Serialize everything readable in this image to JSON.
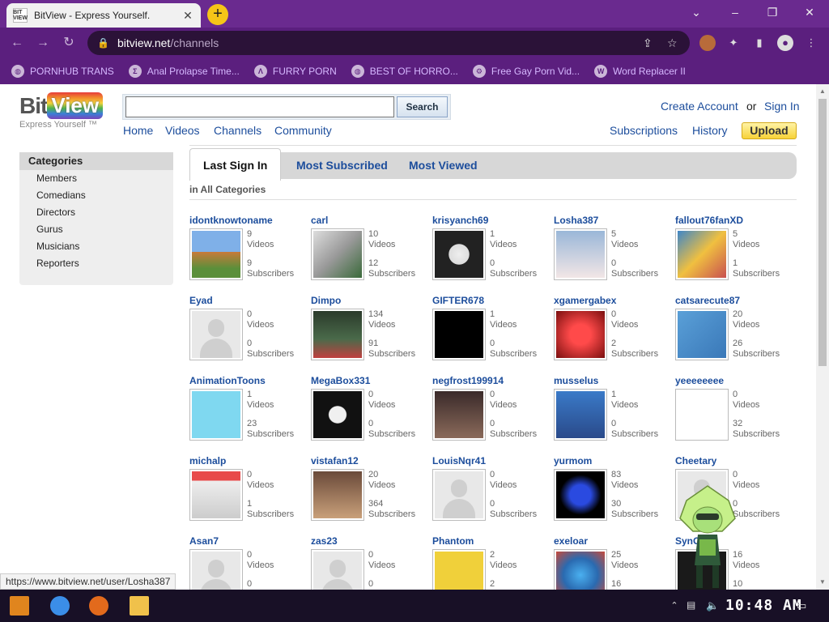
{
  "browser": {
    "tab_title": "BitView - Express Yourself.",
    "favicon_text": "BIT VIEW",
    "new_tab": "+",
    "url_host": "bitview.net",
    "url_path": "/channels",
    "status_url": "https://www.bitview.net/user/Losha387",
    "bookmarks": [
      {
        "label": "PORNHUB TRANS",
        "icon": "globe-icon"
      },
      {
        "label": "Anal Prolapse Time...",
        "icon": "sigma-icon"
      },
      {
        "label": "FURRY PORN",
        "icon": "lambda-icon"
      },
      {
        "label": "BEST OF HORRO...",
        "icon": "globe-icon"
      },
      {
        "label": "Free Gay Porn Vid...",
        "icon": "gear-icon"
      },
      {
        "label": "Word Replacer II",
        "icon": "wr-icon"
      }
    ]
  },
  "site": {
    "logo_bit": "Bit",
    "logo_view": "View",
    "tagline": "Express Yourself ™",
    "search_button": "Search",
    "search_value": "",
    "nav": [
      "Home",
      "Videos",
      "Channels",
      "Community"
    ],
    "create_account": "Create Account",
    "or": "or",
    "sign_in": "Sign In",
    "subscriptions": "Subscriptions",
    "history": "History",
    "upload": "Upload"
  },
  "sidebar": {
    "title": "Categories",
    "items": [
      "Members",
      "Comedians",
      "Directors",
      "Gurus",
      "Musicians",
      "Reporters"
    ]
  },
  "tabs": {
    "items": [
      "Last Sign In",
      "Most Subscribed",
      "Most Viewed"
    ],
    "active": "Last Sign In"
  },
  "filter_label": "in All Categories",
  "stat_labels": {
    "videos": "Videos",
    "subscribers": "Subscribers"
  },
  "channels": [
    {
      "name": "idontknowtoname",
      "videos": "9",
      "subscribers": "9"
    },
    {
      "name": "carl",
      "videos": "10",
      "subscribers": "12"
    },
    {
      "name": "krisyanch69",
      "videos": "1",
      "subscribers": "0"
    },
    {
      "name": "Losha387",
      "videos": "5",
      "subscribers": "0"
    },
    {
      "name": "fallout76fanXD",
      "videos": "5",
      "subscribers": "1"
    },
    {
      "name": "Eyad",
      "videos": "0",
      "subscribers": "0"
    },
    {
      "name": "Dimpo",
      "videos": "134",
      "subscribers": "91"
    },
    {
      "name": "GIFTER678",
      "videos": "1",
      "subscribers": "0"
    },
    {
      "name": "xgamergabex",
      "videos": "0",
      "subscribers": "2"
    },
    {
      "name": "catsarecute87",
      "videos": "20",
      "subscribers": "26"
    },
    {
      "name": "AnimationToons",
      "videos": "1",
      "subscribers": "23"
    },
    {
      "name": "MegaBox331",
      "videos": "0",
      "subscribers": "0"
    },
    {
      "name": "negfrost199914",
      "videos": "0",
      "subscribers": "0"
    },
    {
      "name": "musselus",
      "videos": "1",
      "subscribers": "0"
    },
    {
      "name": "yeeeeeeee",
      "videos": "0",
      "subscribers": "32"
    },
    {
      "name": "michalp",
      "videos": "0",
      "subscribers": "1"
    },
    {
      "name": "vistafan12",
      "videos": "20",
      "subscribers": "364"
    },
    {
      "name": "LouisNqr41",
      "videos": "0",
      "subscribers": "0"
    },
    {
      "name": "yurmom",
      "videos": "83",
      "subscribers": "30"
    },
    {
      "name": "Cheetary",
      "videos": "0",
      "subscribers": "0"
    },
    {
      "name": "Asan7",
      "videos": "0",
      "subscribers": "0"
    },
    {
      "name": "zas23",
      "videos": "0",
      "subscribers": "0"
    },
    {
      "name": "Phantom",
      "videos": "2",
      "subscribers": "2"
    },
    {
      "name": "exeloar",
      "videos": "25",
      "subscribers": "16"
    },
    {
      "name": "SynCr...d",
      "videos": "16",
      "subscribers": "10"
    }
  ],
  "taskbar": {
    "clock": "10:48 AM"
  },
  "colors": {
    "chrome": "#5b1f7e",
    "link": "#1c4d9c",
    "upload": "#f7d238"
  }
}
